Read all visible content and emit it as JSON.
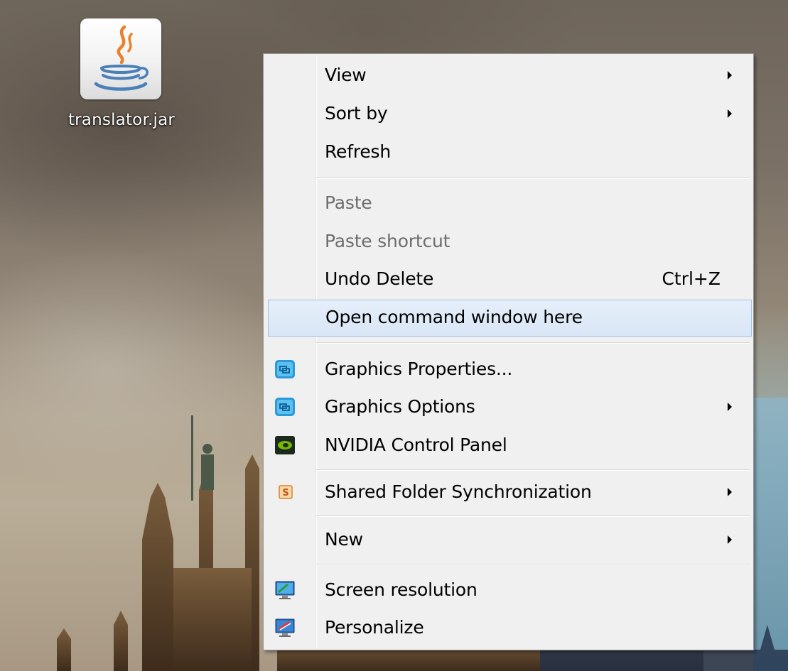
{
  "desktop": {
    "icon": {
      "label": "translator.jar",
      "icon_name": "java-jar-icon"
    }
  },
  "context_menu": {
    "groups": [
      [
        {
          "label": "View",
          "submenu": true
        },
        {
          "label": "Sort by",
          "submenu": true
        },
        {
          "label": "Refresh"
        }
      ],
      [
        {
          "label": "Paste",
          "disabled": true
        },
        {
          "label": "Paste shortcut",
          "disabled": true
        },
        {
          "label": "Undo Delete",
          "shortcut": "Ctrl+Z"
        },
        {
          "label": "Open command window here",
          "highlighted": true
        }
      ],
      [
        {
          "label": "Graphics Properties...",
          "icon": "intel-graphics-icon"
        },
        {
          "label": "Graphics Options",
          "icon": "intel-graphics-icon",
          "submenu": true
        },
        {
          "label": "NVIDIA Control Panel",
          "icon": "nvidia-icon"
        }
      ],
      [
        {
          "label": "Shared Folder Synchronization",
          "icon": "shared-folder-sync-icon",
          "submenu": true
        }
      ],
      [
        {
          "label": "New",
          "submenu": true
        }
      ],
      [
        {
          "label": "Screen resolution",
          "icon": "screen-resolution-icon"
        },
        {
          "label": "Personalize",
          "icon": "personalize-icon"
        }
      ]
    ]
  }
}
